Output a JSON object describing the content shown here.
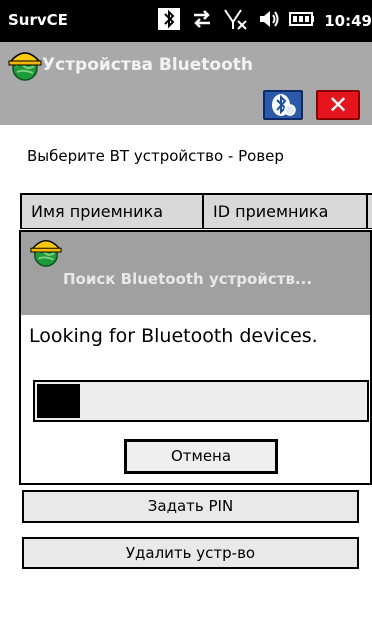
{
  "status_bar": {
    "app_name": "SurvCE",
    "time": "10:49",
    "icons": [
      "bluetooth-icon",
      "data-sync-icon",
      "no-signal-icon",
      "volume-icon",
      "battery-icon"
    ]
  },
  "window": {
    "title": "Устройства Bluetooth",
    "title_icon": "helmet-globe-icon",
    "bluetooth_button_icon": "bluetooth-search-icon",
    "close_button_symbol": "✕",
    "close_button_color": "#e4151d"
  },
  "main": {
    "prompt": "Выберите BT устройство - Ровер",
    "columns": [
      "Имя приемника",
      "ID приемника"
    ],
    "set_pin_label": "Задать PIN",
    "remove_device_label": "Удалить устр-во"
  },
  "dialog": {
    "title": "Поиск Bluetooth устройств...",
    "message": "Looking for Bluetooth devices.",
    "progress_fraction": 0.13,
    "cancel_label": "Отмена"
  }
}
